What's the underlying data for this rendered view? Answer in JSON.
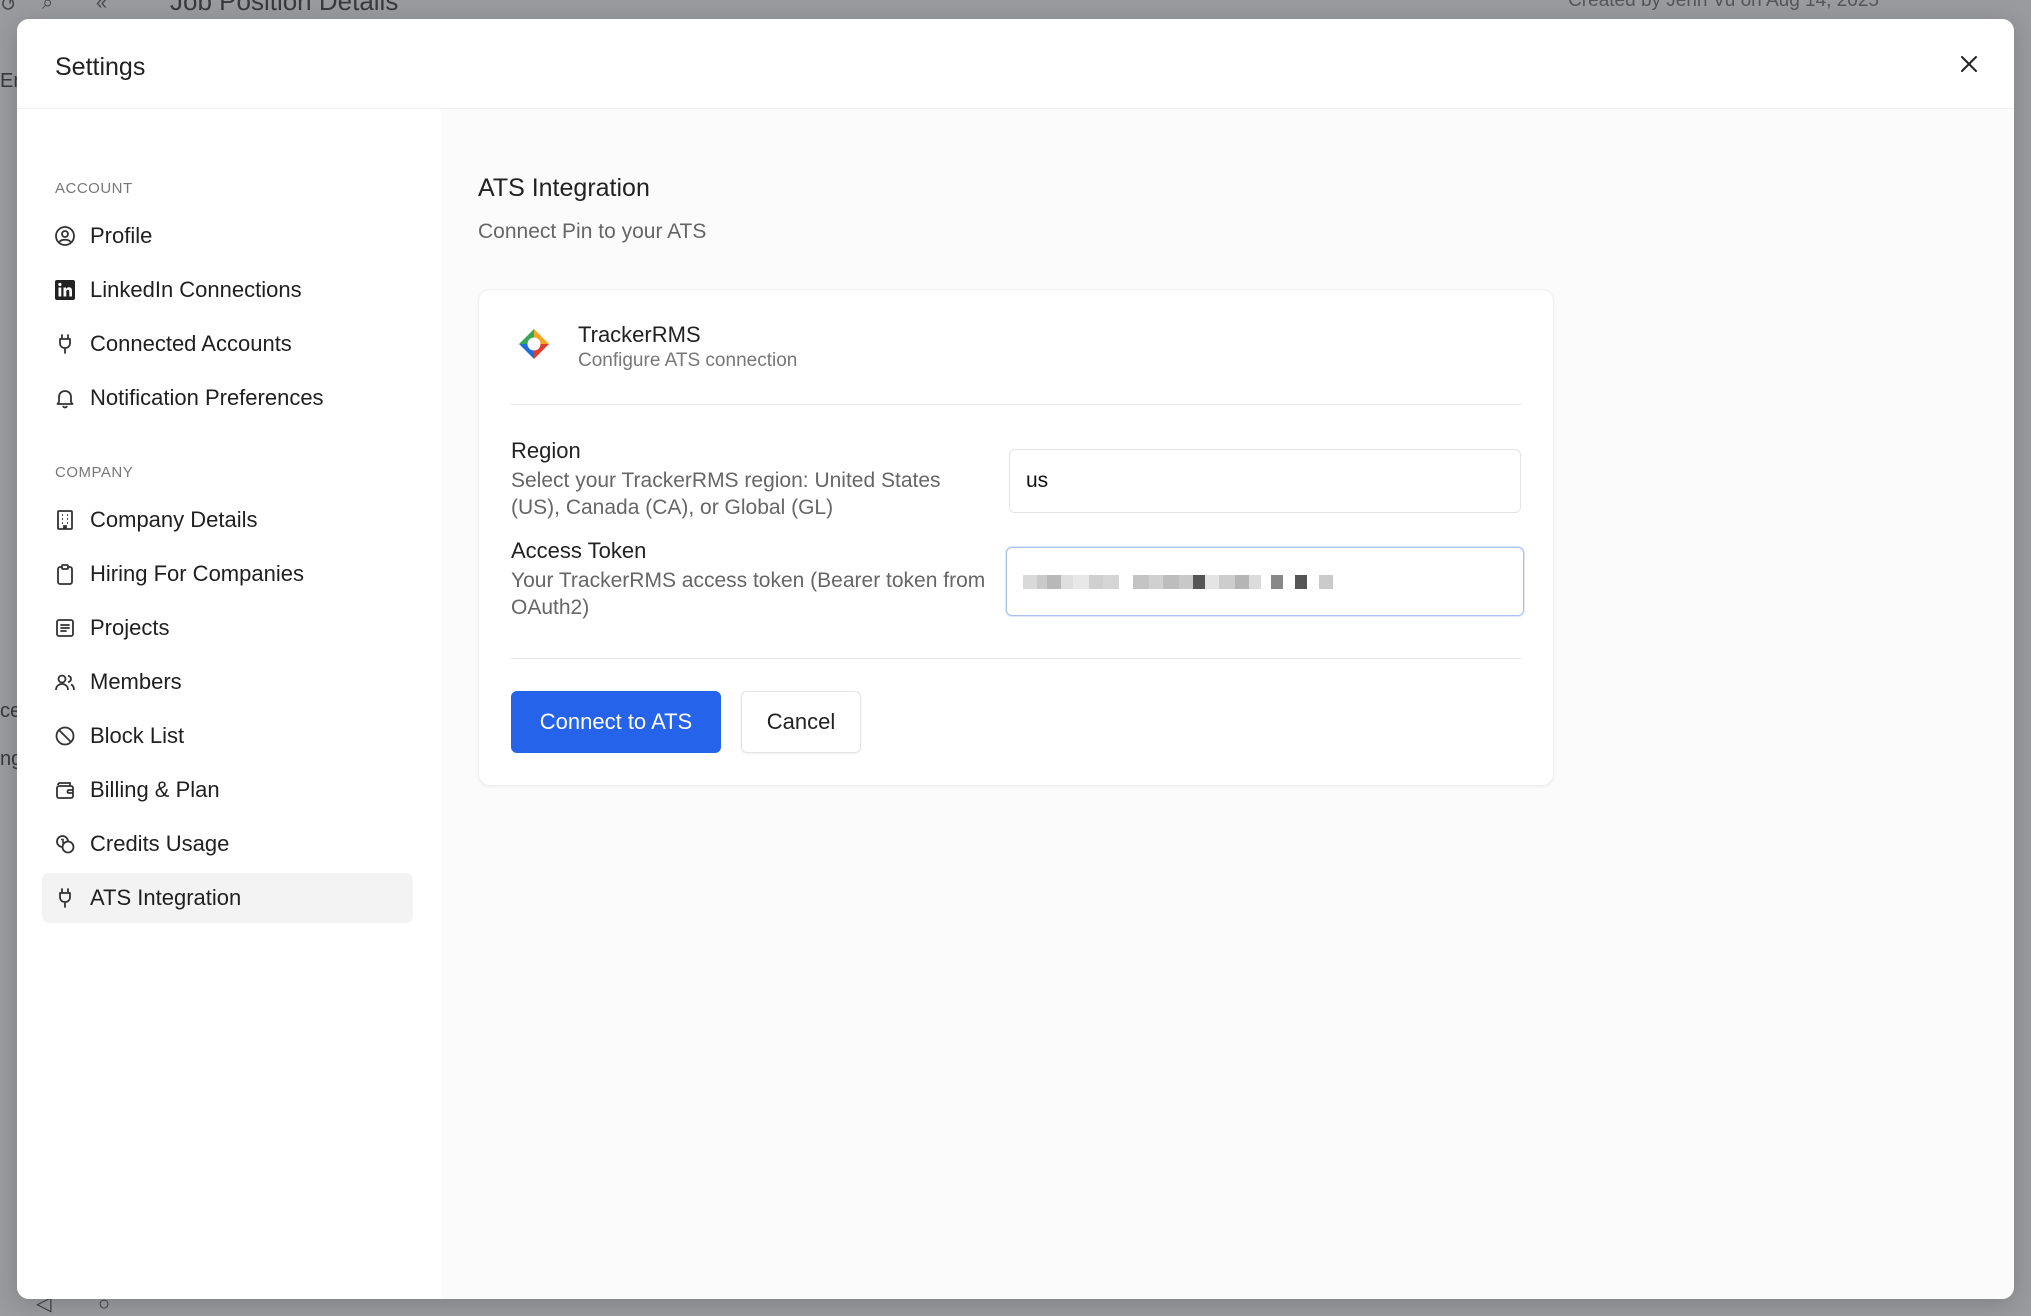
{
  "background": {
    "page_title": "Job Position Details",
    "created_text": "Created by Jenn Vu on Aug 14, 2025",
    "side_fragments": [
      "En",
      "ce",
      "ng"
    ]
  },
  "modal": {
    "title": "Settings"
  },
  "sidebar": {
    "account_label": "ACCOUNT",
    "company_label": "COMPANY",
    "account_items": [
      {
        "label": "Profile",
        "icon": "user-circle-icon"
      },
      {
        "label": "LinkedIn Connections",
        "icon": "linkedin-icon"
      },
      {
        "label": "Connected Accounts",
        "icon": "plug-icon"
      },
      {
        "label": "Notification Preferences",
        "icon": "bell-icon"
      }
    ],
    "company_items": [
      {
        "label": "Company Details",
        "icon": "building-icon"
      },
      {
        "label": "Hiring For Companies",
        "icon": "clipboard-icon"
      },
      {
        "label": "Projects",
        "icon": "list-icon"
      },
      {
        "label": "Members",
        "icon": "users-icon"
      },
      {
        "label": "Block List",
        "icon": "ban-icon"
      },
      {
        "label": "Billing & Plan",
        "icon": "wallet-icon"
      },
      {
        "label": "Credits Usage",
        "icon": "coins-icon"
      },
      {
        "label": "ATS Integration",
        "icon": "plug-icon",
        "active": true
      }
    ]
  },
  "main": {
    "title": "ATS Integration",
    "subtitle": "Connect Pin to your ATS",
    "provider": {
      "name": "TrackerRMS",
      "description": "Configure ATS connection"
    },
    "region": {
      "label": "Region",
      "help": "Select your TrackerRMS region: United States (US), Canada (CA), or Global (GL)",
      "value": "us"
    },
    "token": {
      "label": "Access Token",
      "help": "Your TrackerRMS access token (Bearer token from OAuth2)"
    },
    "buttons": {
      "connect": "Connect to ATS",
      "cancel": "Cancel"
    }
  },
  "colors": {
    "primary": "#2563eb",
    "active_nav_bg": "#f3f3f4",
    "content_bg": "#fbfbfb"
  }
}
